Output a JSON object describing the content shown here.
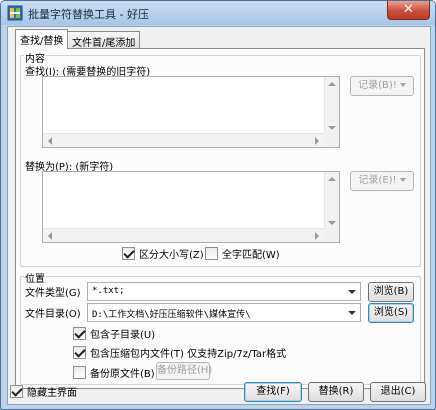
{
  "window": {
    "title": "批量字符替换工具 - 好压",
    "close_label": "✕"
  },
  "tabs": [
    {
      "label": "查找/替换",
      "active": true
    },
    {
      "label": "文件首/尾添加",
      "active": false
    }
  ],
  "content_group": {
    "title": "内容",
    "find_label": "查找(I): (需要替换的旧字符)",
    "find_value": "",
    "find_history_label": "记录(B)!",
    "replace_label": "替换为(P): (新字符)",
    "replace_value": "",
    "replace_history_label": "记录(E)!",
    "case_sensitive": {
      "label": "区分大小写(Z)",
      "checked": true
    },
    "whole_word": {
      "label": "全字匹配(W)",
      "checked": false
    }
  },
  "location_group": {
    "title": "位置",
    "file_type_label": "文件类型(G)",
    "file_type_value": "*.txt;",
    "browse_type_label": "浏览(B)",
    "file_dir_label": "文件目录(O)",
    "file_dir_value": "D:\\工作文档\\好压压缩软件\\媒体宣传\\",
    "browse_dir_label": "浏览(S)",
    "include_subdirs": {
      "label": "包含子目录(U)",
      "checked": true
    },
    "include_archives": {
      "label": "包含压缩包内文件(T) 仅支持Zip/7z/Tar格式",
      "checked": true
    },
    "backup_files": {
      "label": "备份原文件(B)",
      "checked": false
    },
    "backup_path_label": "备份路径(H)"
  },
  "footer": {
    "hide_main": {
      "label": "隐藏主界面",
      "checked": true
    },
    "find_button": "查找(F)",
    "replace_button": "替换(R)",
    "exit_button": "退出(C)"
  },
  "colors": {
    "title_bar": "#bcd3ea",
    "close_button": "#c9503c",
    "panel": "#f0f0f0"
  }
}
